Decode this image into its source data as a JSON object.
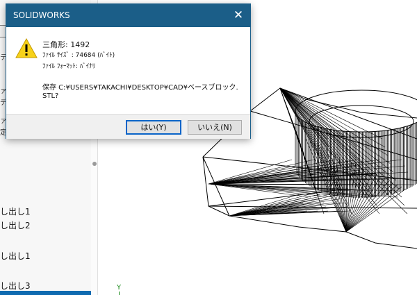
{
  "dialog": {
    "title": "SOLIDWORKS",
    "close_glyph": "✕",
    "icon": "warning-icon",
    "triangles_line": "三角形: 1492",
    "filesize_line": "ﾌｧｲﾙ ｻｲｽﾞ : 74684 (ﾊﾞｲﾄ)",
    "format_line": "ﾌｧｲﾙ ﾌｫｰﾏｯﾄ: ﾊﾞｲﾅﾘ",
    "save_line1": "保存 C:¥USERS¥TAKACHI¥DESKTOP¥CAD¥ベースブロック.",
    "save_line2": "STL?",
    "yes_label": "はい(Y)",
    "no_label": "いいえ(N)"
  },
  "left_panel": {
    "fragments": [
      "テ",
      "ァ",
      "デ",
      "ァ",
      "定"
    ],
    "items": [
      "し出し1",
      "し出し2",
      "し出し1",
      "し出し3"
    ]
  },
  "viewport": {
    "axis_label": "Y"
  },
  "colors": {
    "titlebar": "#1b5e88",
    "axis": "#1a8a1a",
    "accent_button_border": "#0a64c8"
  }
}
